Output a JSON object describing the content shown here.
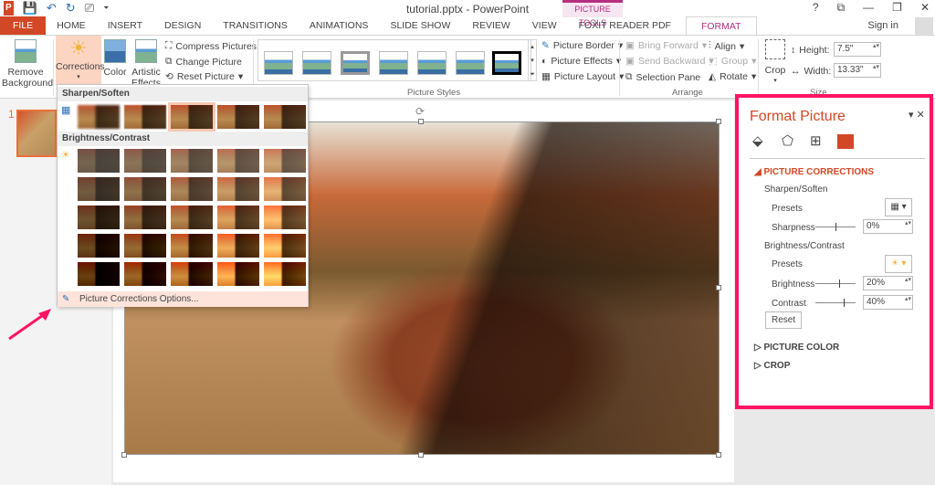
{
  "window": {
    "title": "tutorial.pptx - PowerPoint",
    "contextual_tab_group": "PICTURE TOOLS",
    "controls": [
      "?",
      "⧉",
      "—",
      "❐",
      "✕"
    ],
    "sign_in": "Sign in"
  },
  "qat": [
    "P",
    "💾",
    "↶",
    "↻",
    "⎚",
    "⏷"
  ],
  "tabs": [
    "FILE",
    "HOME",
    "INSERT",
    "DESIGN",
    "TRANSITIONS",
    "ANIMATIONS",
    "SLIDE SHOW",
    "REVIEW",
    "VIEW",
    "FOXIT READER PDF",
    "FORMAT"
  ],
  "active_tab": "FORMAT",
  "ribbon": {
    "remove_background": "Remove Background",
    "corrections": "Corrections",
    "color": "Color",
    "artistic_effects": "Artistic Effects",
    "compress": "Compress Pictures",
    "change": "Change Picture",
    "reset": "Reset Picture",
    "picture_styles_label": "Picture Styles",
    "border": "Picture Border",
    "effects": "Picture Effects",
    "layout": "Picture Layout",
    "bring_forward": "Bring Forward",
    "send_backward": "Send Backward",
    "selection_pane": "Selection Pane",
    "align": "Align",
    "group": "Group",
    "rotate": "Rotate",
    "arrange_label": "Arrange",
    "crop": "Crop",
    "height_label": "Height:",
    "height": "7.5\"",
    "width_label": "Width:",
    "width": "13.33\"",
    "size_label": "Size"
  },
  "slides": {
    "number": "1"
  },
  "corrections_menu": {
    "sharpen_header": "Sharpen/Soften",
    "brightness_header": "Brightness/Contrast",
    "options": "Picture Corrections Options...",
    "sharpen_selected_index": 2,
    "brightness_levels_percent": [
      -40,
      -20,
      0,
      20,
      40
    ],
    "contrast_levels_percent": [
      -40,
      -20,
      0,
      20,
      40
    ],
    "selected_cell": {
      "brightness": 20,
      "contrast": 40
    }
  },
  "format_pane": {
    "title": "Format Picture",
    "accent": "#d24726",
    "highlight_border": "#ff1464",
    "section": "PICTURE CORRECTIONS",
    "sharpen_label": "Sharpen/Soften",
    "presets": "Presets",
    "sharpness": "Sharpness",
    "sharpness_value": "0%",
    "bc_label": "Brightness/Contrast",
    "presets2": "Presets",
    "brightness": "Brightness",
    "brightness_value": "20%",
    "contrast": "Contrast",
    "contrast_value": "40%",
    "reset": "Reset",
    "picture_color": "PICTURE COLOR",
    "crop": "CROP"
  }
}
